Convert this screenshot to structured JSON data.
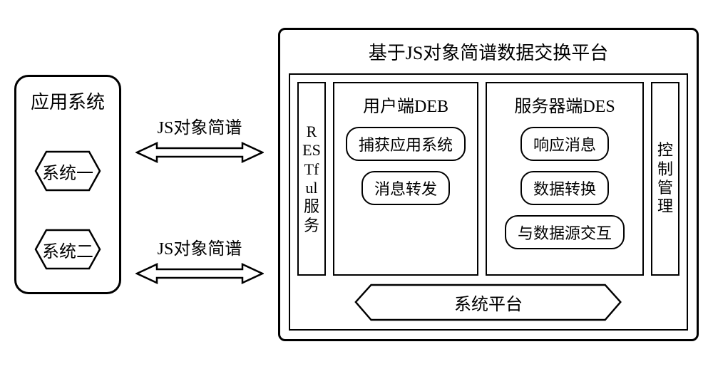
{
  "left": {
    "title": "应用系统",
    "system1": "系统一",
    "system2": "系统二"
  },
  "arrows": {
    "label1": "JS对象简谱",
    "label2": "JS对象简谱"
  },
  "right": {
    "title": "基于JS对象简谱数据交换平台",
    "restful": "RESTful服务",
    "deb": {
      "title": "用户端DEB",
      "item1": "捕获应用系统",
      "item2": "消息转发"
    },
    "des": {
      "title": "服务器端DES",
      "item1": "响应消息",
      "item2": "数据转换",
      "item3": "与数据源交互"
    },
    "control": "控制管理",
    "platform": "系统平台"
  }
}
